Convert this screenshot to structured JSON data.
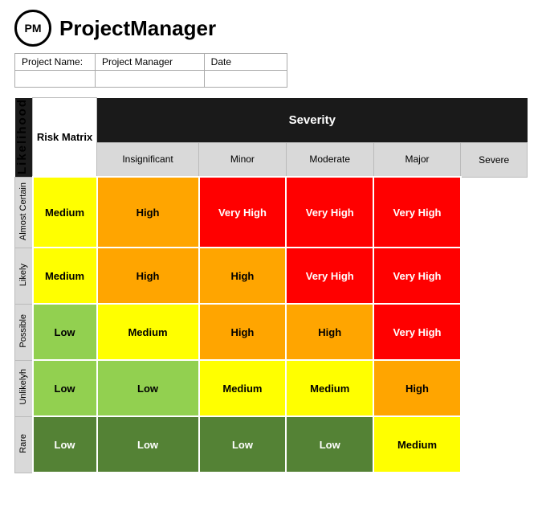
{
  "header": {
    "logo_text": "PM",
    "app_name": "ProjectManager"
  },
  "project_info": {
    "fields": [
      {
        "label": "Project Name:",
        "value": ""
      },
      {
        "label": "Project Manager",
        "value": ""
      },
      {
        "label": "Date",
        "value": ""
      }
    ]
  },
  "matrix": {
    "title": "Risk Matrix",
    "severity_label": "Severity",
    "likelihood_label": "Likelihood",
    "col_headers": [
      "Insignificant",
      "Minor",
      "Moderate",
      "Major",
      "Severe"
    ],
    "rows": [
      {
        "label": "Almost Certain",
        "cells": [
          {
            "value": "Medium",
            "color_class": "risk-medium-yellow"
          },
          {
            "value": "High",
            "color_class": "risk-high-orange"
          },
          {
            "value": "Very High",
            "color_class": "risk-very-high-red"
          },
          {
            "value": "Very High",
            "color_class": "risk-very-high-red"
          },
          {
            "value": "Very High",
            "color_class": "risk-very-high-red"
          }
        ]
      },
      {
        "label": "Likely",
        "cells": [
          {
            "value": "Medium",
            "color_class": "risk-medium-yellow"
          },
          {
            "value": "High",
            "color_class": "risk-high-orange"
          },
          {
            "value": "High",
            "color_class": "risk-high-orange"
          },
          {
            "value": "Very High",
            "color_class": "risk-very-high-red"
          },
          {
            "value": "Very High",
            "color_class": "risk-very-high-red"
          }
        ]
      },
      {
        "label": "Possible",
        "cells": [
          {
            "value": "Low",
            "color_class": "risk-low-green"
          },
          {
            "value": "Medium",
            "color_class": "risk-medium-yellow"
          },
          {
            "value": "High",
            "color_class": "risk-high-orange"
          },
          {
            "value": "High",
            "color_class": "risk-high-orange"
          },
          {
            "value": "Very High",
            "color_class": "risk-very-high-red"
          }
        ]
      },
      {
        "label": "Unlikelyh",
        "cells": [
          {
            "value": "Low",
            "color_class": "risk-low-green"
          },
          {
            "value": "Low",
            "color_class": "risk-low-green"
          },
          {
            "value": "Medium",
            "color_class": "risk-medium-yellow"
          },
          {
            "value": "Medium",
            "color_class": "risk-medium-yellow"
          },
          {
            "value": "High",
            "color_class": "risk-high-orange"
          }
        ]
      },
      {
        "label": "Rare",
        "cells": [
          {
            "value": "Low",
            "color_class": "risk-low-dark"
          },
          {
            "value": "Low",
            "color_class": "risk-low-dark"
          },
          {
            "value": "Low",
            "color_class": "risk-low-dark"
          },
          {
            "value": "Low",
            "color_class": "risk-low-dark"
          },
          {
            "value": "Medium",
            "color_class": "risk-medium-yellow"
          }
        ]
      }
    ]
  }
}
